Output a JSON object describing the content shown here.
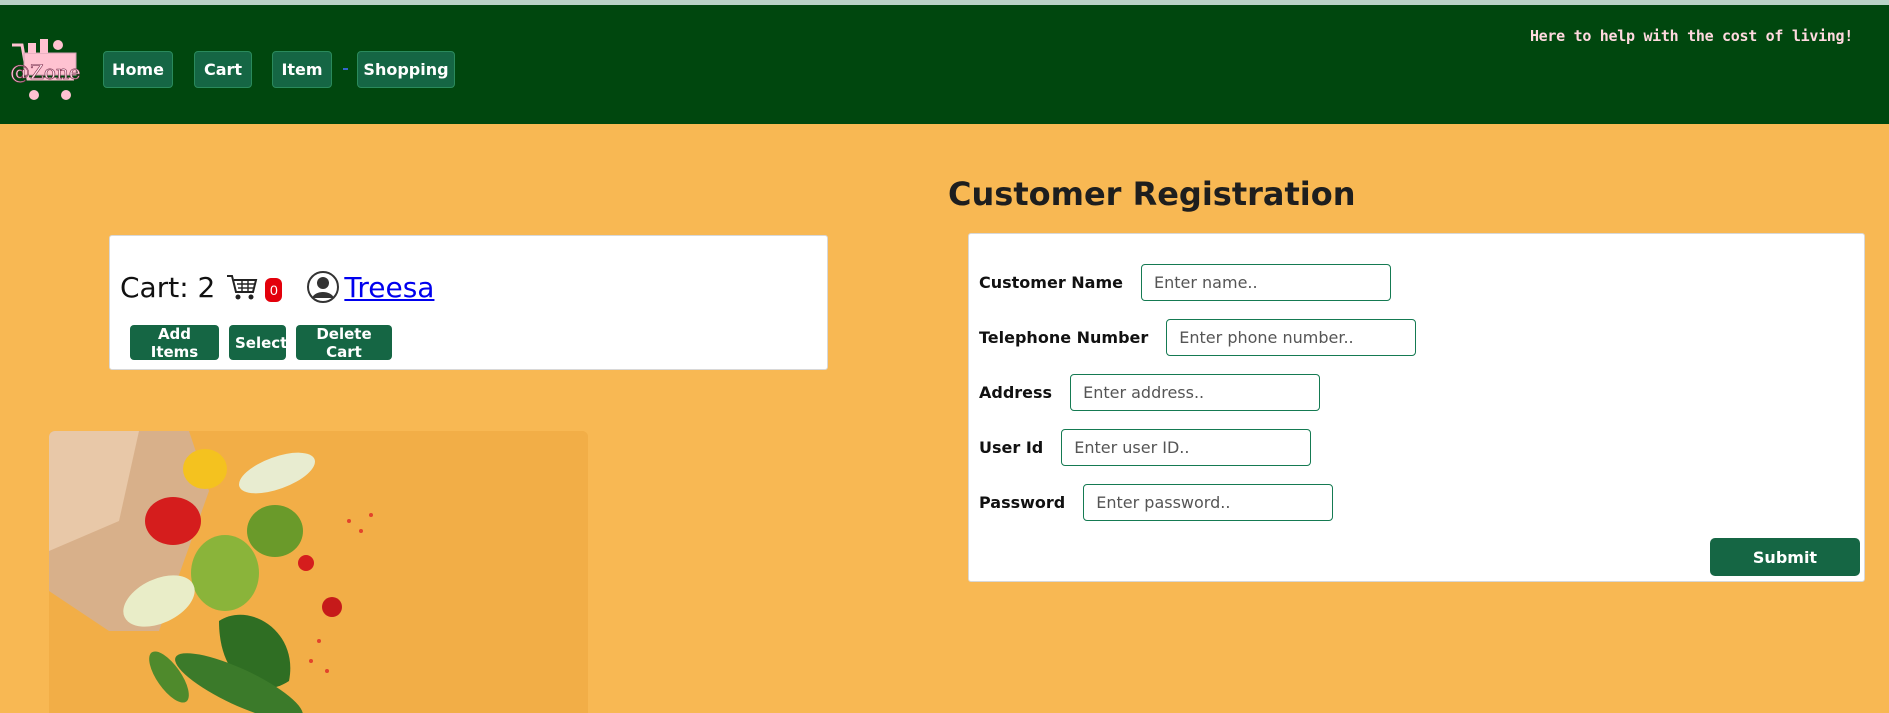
{
  "header": {
    "logo_text": "@Zone",
    "nav": [
      "Home",
      "Cart",
      "Item",
      "Shopping"
    ],
    "tagline": "Here to help with the cost of living!"
  },
  "cart": {
    "label": "Cart: 2",
    "badge_count": "0",
    "user_name": "Treesa",
    "actions": [
      "Add Items",
      "Select",
      "Delete Cart"
    ]
  },
  "registration": {
    "title": "Customer Registration",
    "fields": [
      {
        "label": "Customer Name",
        "placeholder": "Enter name.."
      },
      {
        "label": "Telephone Number",
        "placeholder": "Enter phone number.."
      },
      {
        "label": "Address",
        "placeholder": "Enter address.."
      },
      {
        "label": "User Id",
        "placeholder": "Enter user ID.."
      },
      {
        "label": "Password",
        "placeholder": "Enter password.."
      }
    ],
    "submit_label": "Submit"
  },
  "colors": {
    "page_bg": "#f8b853",
    "navbar_bg": "#00470e",
    "button_bg": "#156644",
    "tagline": "#ffd9df",
    "badge": "#e3000b"
  },
  "icons": [
    "cart-logo-icon",
    "shopping-cart-icon",
    "user-avatar-icon"
  ]
}
